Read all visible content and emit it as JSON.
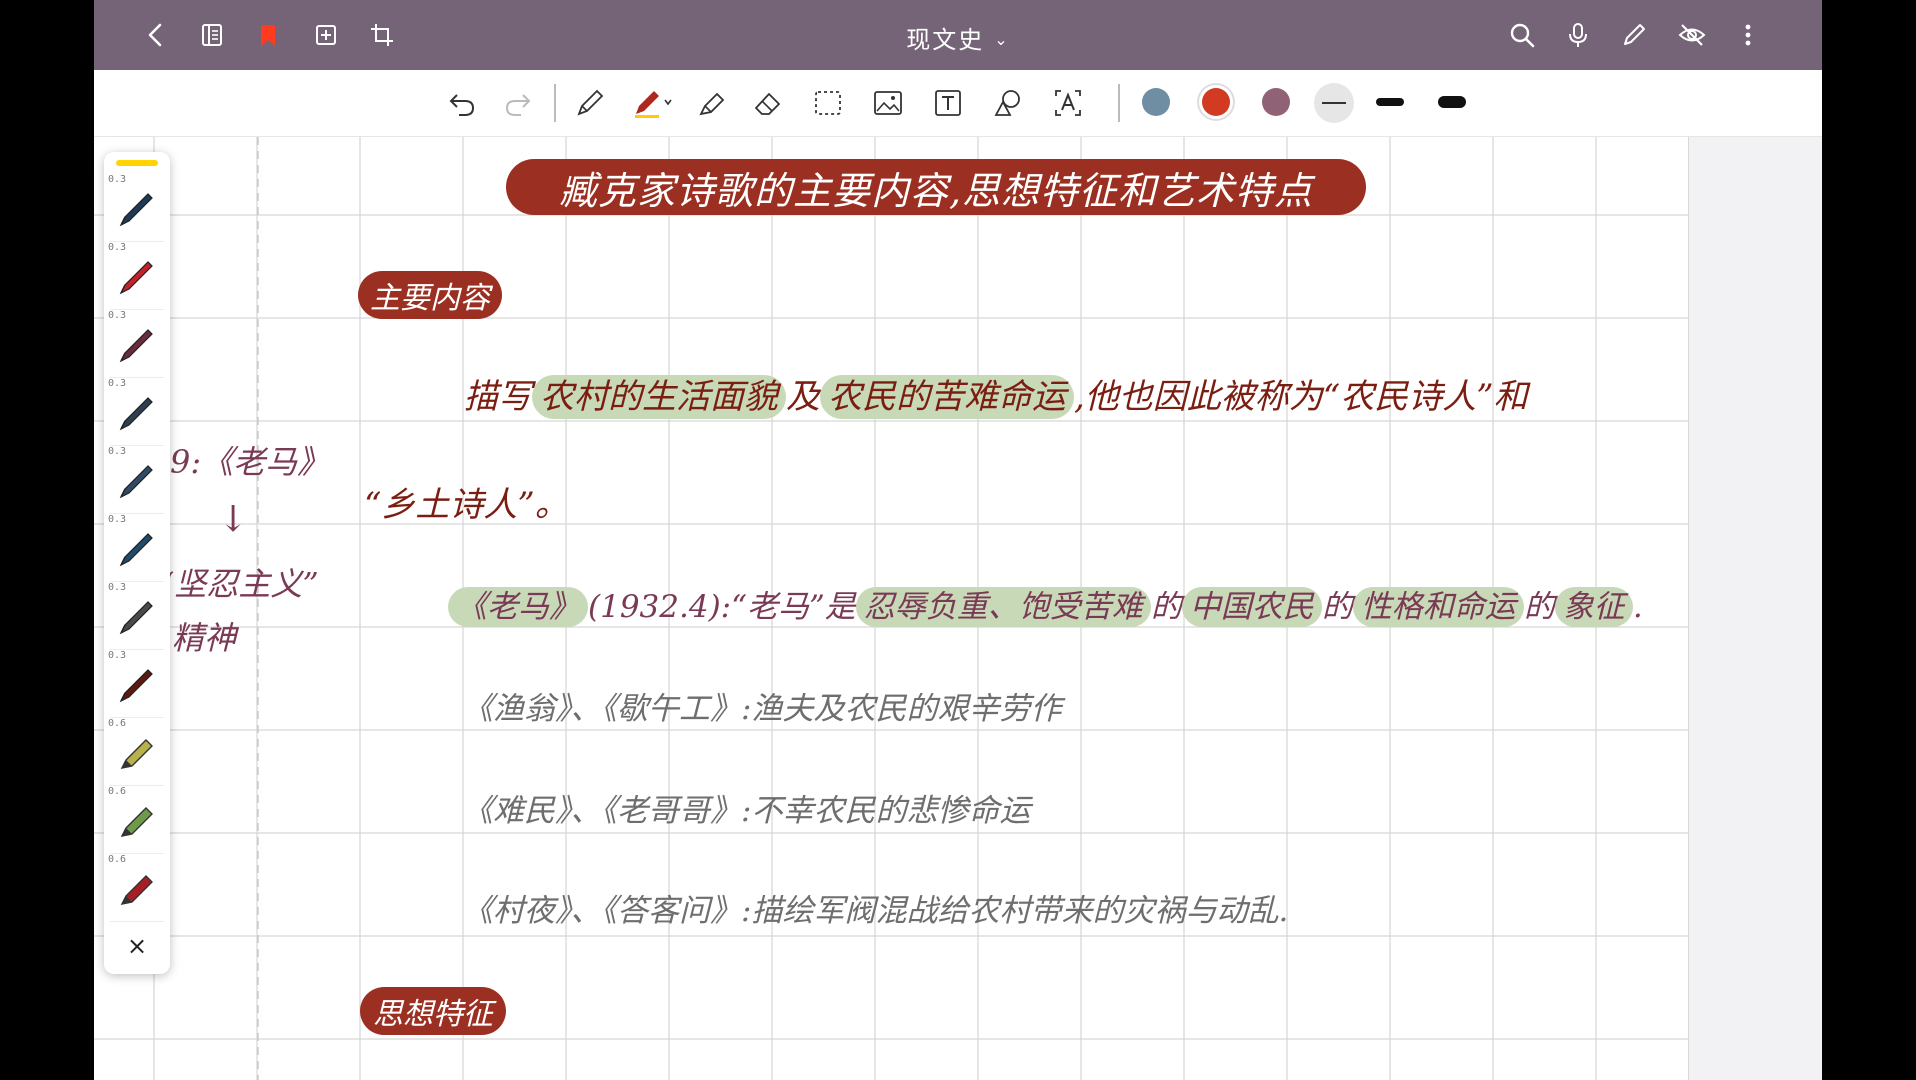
{
  "app": {
    "doc_title": "现文史",
    "colors": {
      "bar": "#756378",
      "banner": "#9b3022",
      "highlight": "#c8d9b8",
      "ink_dark": "#7a1e12",
      "ink_plum": "#7a3a55",
      "ink_gray": "#6e6e6e"
    }
  },
  "topbar": {
    "left_icons": [
      "back-icon",
      "pages-icon",
      "bookmark-icon",
      "add-page-icon",
      "crop-icon"
    ],
    "right_icons": [
      "search-icon",
      "mic-icon",
      "pencil-icon",
      "hide-eye-icon",
      "more-icon"
    ]
  },
  "toolbar": {
    "tools": [
      "undo-icon",
      "redo-icon",
      "pencil-tool-icon",
      "pen-tool-icon",
      "highlighter-icon",
      "eraser-icon",
      "lasso-select-icon",
      "image-icon",
      "text-box-icon",
      "shape-icon",
      "text-recognition-icon"
    ],
    "swatches": [
      "#6f8ea3",
      "#d23a22",
      "#8f6276",
      "#444444"
    ]
  },
  "note": {
    "title": "臧克家诗歌的主要内容,思想特征和艺术特点",
    "section1": "主要内容",
    "para1_a": "描写",
    "para1_hl1": "农村的生活面貌",
    "para1_b": "及",
    "para1_hl2": "农民的苦难命运",
    "para1_c": ",他也因此被称为“农民诗人”和",
    "para1_d": "“乡土诗人”。",
    "line2_hl1": "《老马》",
    "line2_a": "(1932.4):“老马”是",
    "line2_hl2": "忍辱负重、饱受苦难",
    "line2_b": "的",
    "line2_hl3": "中国农民",
    "line2_c": "的",
    "line2_hl4": "性格和命运",
    "line2_d": "的",
    "line2_hl5": "象征",
    "line2_e": ".",
    "line3": "《渔翁》、《歇午工》:渔夫及农民的艰辛劳作",
    "line4": "《难民》、《老哥哥》:不幸农民的悲惨命运",
    "line5": "《村夜》、《答客问》:描绘军阀混战给农村带来的灾祸与动乱.",
    "section2": "思想特征"
  },
  "margin": {
    "a": "9:《老马》",
    "arrow": "↓",
    "b": "“坚忍主义”",
    "c": "精神"
  },
  "pens": [
    {
      "size": "0.3",
      "color": "#1d3b55"
    },
    {
      "size": "0.3",
      "color": "#c8202a"
    },
    {
      "size": "0.3",
      "color": "#6a2b3a"
    },
    {
      "size": "0.3",
      "color": "#2c3e50"
    },
    {
      "size": "0.3",
      "color": "#2e4a66"
    },
    {
      "size": "0.3",
      "color": "#1f4a6a"
    },
    {
      "size": "0.3",
      "color": "#4a4a4a"
    },
    {
      "size": "0.3",
      "color": "#5a1a12"
    },
    {
      "size": "0.6",
      "color": "#b8b24a"
    },
    {
      "size": "0.6",
      "color": "#6f9a4a"
    },
    {
      "size": "0.6",
      "color": "#a81e24"
    }
  ],
  "pen_close": "×"
}
